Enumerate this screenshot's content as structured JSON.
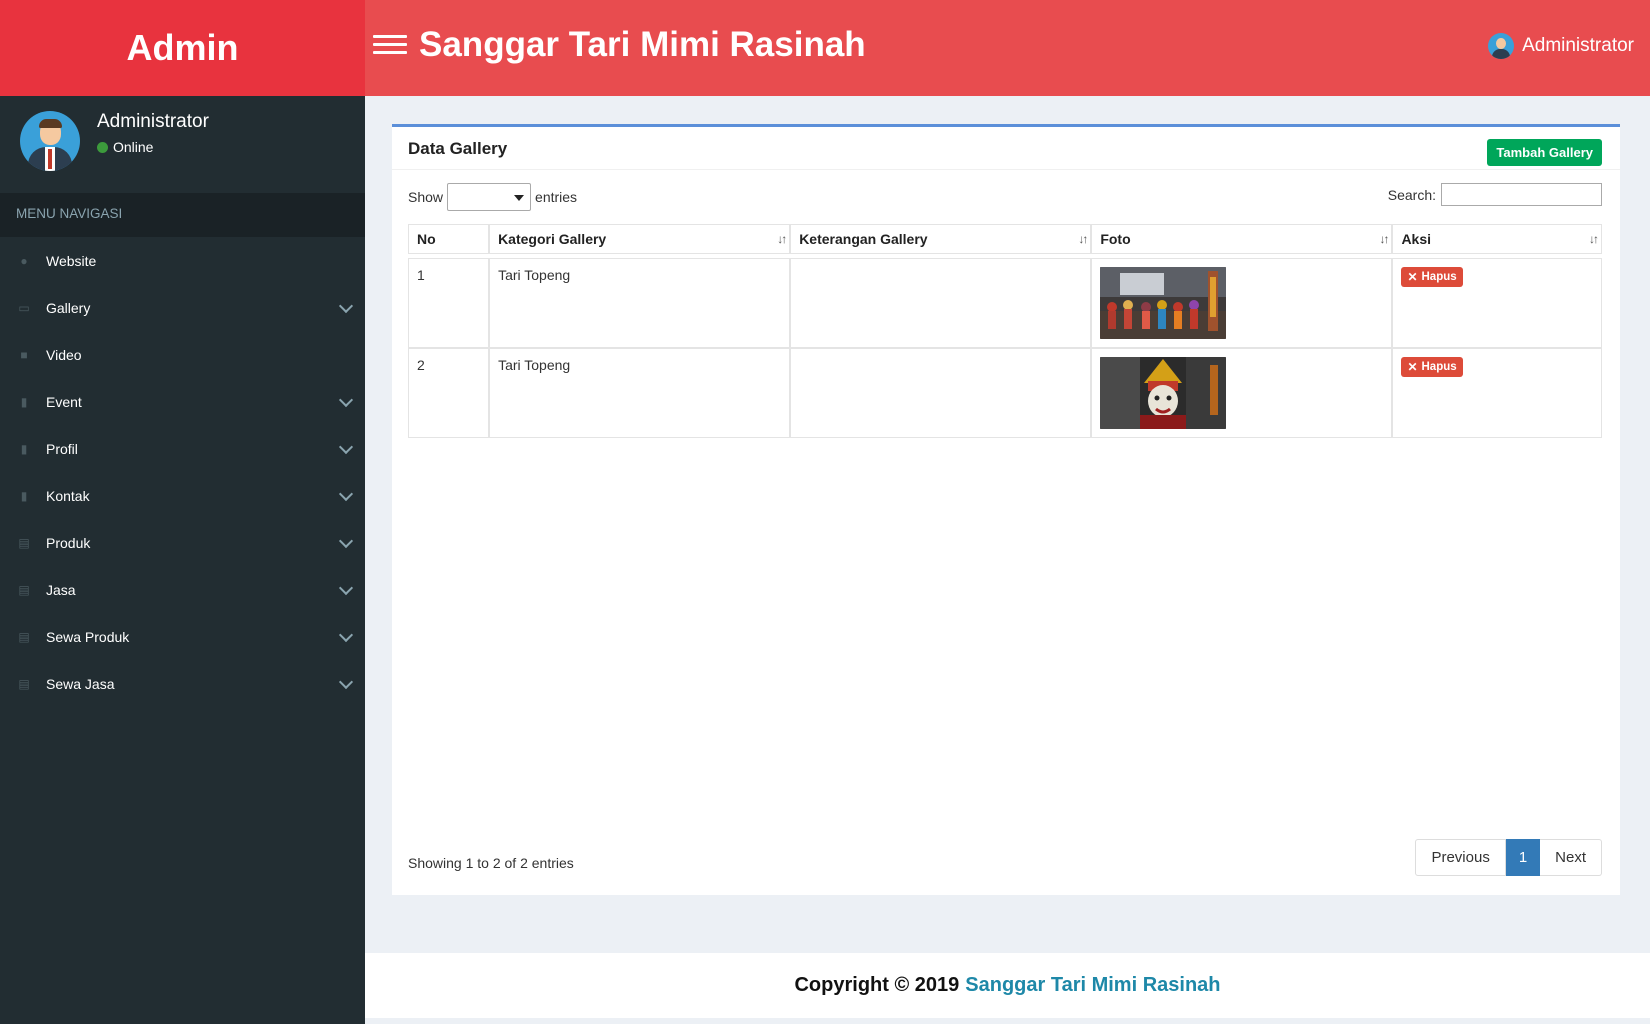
{
  "brand": "Admin",
  "header": {
    "title": "Sanggar Tari Mimi Rasinah",
    "user": "Administrator"
  },
  "sidebar": {
    "user_name": "Administrator",
    "status": "Online",
    "menu_header": "MENU NAVIGASI",
    "items": [
      {
        "label": "Website",
        "icon": "globe-icon",
        "expand": false
      },
      {
        "label": "Gallery",
        "icon": "image-icon",
        "expand": true
      },
      {
        "label": "Video",
        "icon": "video-icon",
        "expand": false
      },
      {
        "label": "Event",
        "icon": "doc-icon",
        "expand": true
      },
      {
        "label": "Profil",
        "icon": "doc-icon",
        "expand": true
      },
      {
        "label": "Kontak",
        "icon": "doc-icon",
        "expand": true
      },
      {
        "label": "Produk",
        "icon": "list-icon",
        "expand": true
      },
      {
        "label": "Jasa",
        "icon": "list-icon",
        "expand": true
      },
      {
        "label": "Sewa Produk",
        "icon": "list-icon",
        "expand": true
      },
      {
        "label": "Sewa Jasa",
        "icon": "list-icon",
        "expand": true
      }
    ]
  },
  "box": {
    "title": "Data Gallery",
    "add_button": "Tambah Gallery",
    "show_label": "Show",
    "entries_label": "entries",
    "search_label": "Search:",
    "search_value": "",
    "columns": [
      "No",
      "Kategori Gallery",
      "Keterangan Gallery",
      "Foto",
      "Aksi"
    ],
    "rows": [
      {
        "no": "1",
        "kategori": "Tari Topeng",
        "keterangan": "",
        "aksi": "Hapus"
      },
      {
        "no": "2",
        "kategori": "Tari Topeng",
        "keterangan": "",
        "aksi": "Hapus"
      }
    ],
    "info": "Showing 1 to 2 of 2 entries",
    "pagination": {
      "previous": "Previous",
      "current": "1",
      "next": "Next"
    }
  },
  "footer": {
    "prefix": "Copyright © 2019",
    "link": "Sanggar Tari Mimi Rasinah"
  },
  "colors": {
    "logo_bg": "#e8333e",
    "topbar_bg": "#e84c4f",
    "sidebar_bg": "#222d32",
    "box_border": "#5b8fd9",
    "add_button": "#00a65a",
    "delete_button": "#dd4b39",
    "page_active": "#337ab7"
  }
}
